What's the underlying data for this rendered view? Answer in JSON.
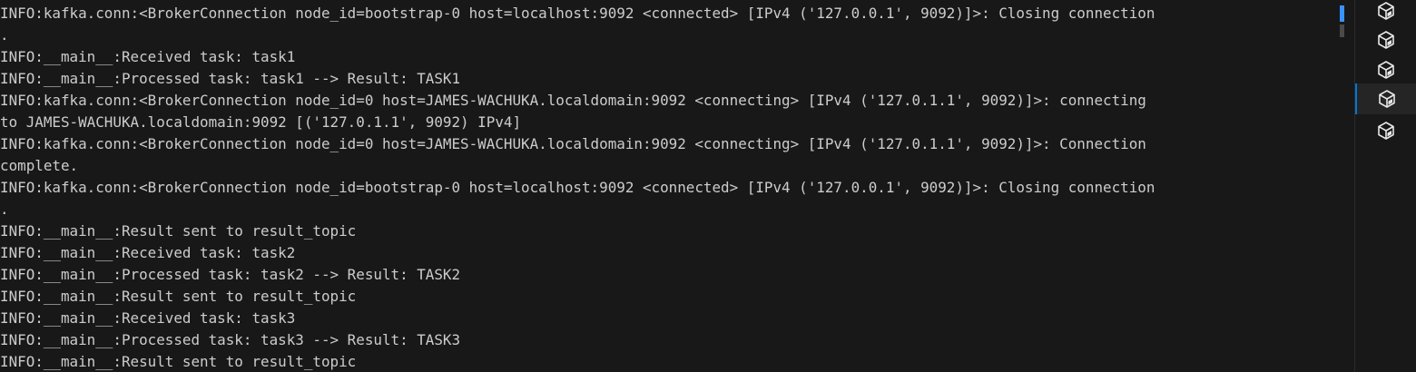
{
  "terminal": {
    "lines": [
      "INFO:kafka.conn:<BrokerConnection node_id=bootstrap-0 host=localhost:9092 <connected> [IPv4 ('127.0.0.1', 9092)]>: Closing connection",
      ".",
      "INFO:__main__:Received task: task1",
      "INFO:__main__:Processed task: task1 --> Result: TASK1",
      "INFO:kafka.conn:<BrokerConnection node_id=0 host=JAMES-WACHUKA.localdomain:9092 <connecting> [IPv4 ('127.0.1.1', 9092)]>: connecting",
      "to JAMES-WACHUKA.localdomain:9092 [('127.0.1.1', 9092) IPv4]",
      "INFO:kafka.conn:<BrokerConnection node_id=0 host=JAMES-WACHUKA.localdomain:9092 <connecting> [IPv4 ('127.0.1.1', 9092)]>: Connection",
      "complete.",
      "INFO:kafka.conn:<BrokerConnection node_id=bootstrap-0 host=localhost:9092 <connected> [IPv4 ('127.0.0.1', 9092)]>: Closing connection",
      ".",
      "INFO:__main__:Result sent to result_topic",
      "INFO:__main__:Received task: task2",
      "INFO:__main__:Processed task: task2 --> Result: TASK2",
      "INFO:__main__:Result sent to result_topic",
      "INFO:__main__:Received task: task3",
      "INFO:__main__:Processed task: task3 --> Result: TASK3",
      "INFO:__main__:Result sent to result_topic"
    ]
  },
  "side_panel": {
    "tabs": [
      {
        "icon": "terminal-cube-icon",
        "active": false
      },
      {
        "icon": "terminal-cube-icon",
        "active": false
      },
      {
        "icon": "terminal-cube-icon",
        "active": false
      },
      {
        "icon": "terminal-cube-icon",
        "active": true
      },
      {
        "icon": "terminal-cube-icon",
        "active": false
      }
    ]
  },
  "colors": {
    "background": "#181818",
    "text": "#cccccc",
    "accent": "#0078d4",
    "scroll_thumb": "#3794ff"
  }
}
